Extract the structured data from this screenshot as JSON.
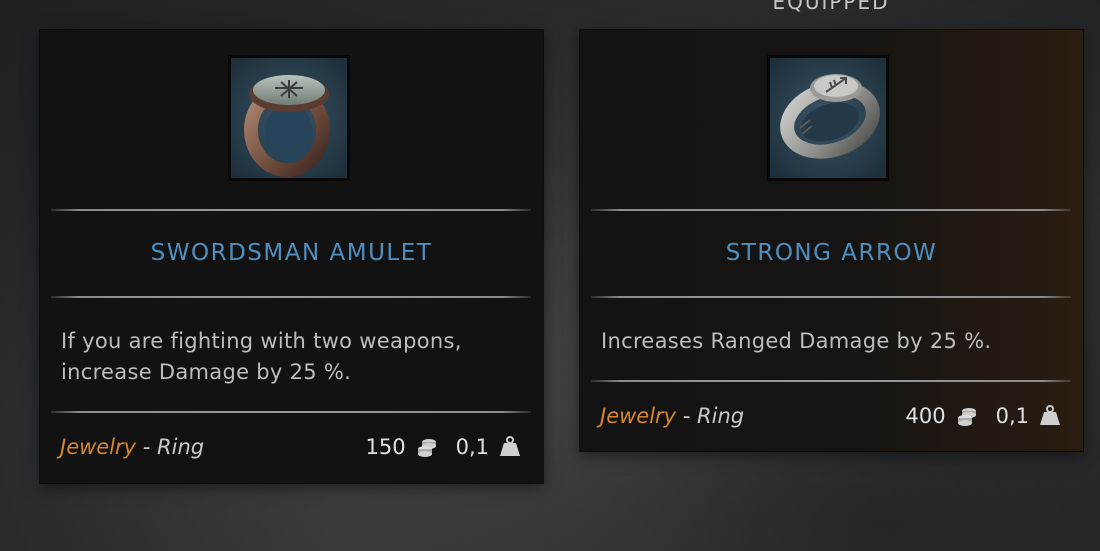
{
  "header": {
    "equipped_label": "EQUIPPED"
  },
  "items": [
    {
      "name": "SWORDSMAN AMULET",
      "description_lines": [
        "If you are fighting with two weapons,",
        "increase Damage by 25 %."
      ],
      "category": "Jewelry",
      "separator": " - ",
      "subtype": "Ring",
      "price": "150",
      "weight": "0,1",
      "icon": "signet-ring-icon",
      "price_icon": "coins-icon",
      "weight_icon": "weight-icon"
    },
    {
      "name": "STRONG ARROW",
      "description_lines": [
        "Increases Ranged Damage by 25 %."
      ],
      "category": "Jewelry",
      "separator": " - ",
      "subtype": "Ring",
      "price": "400",
      "weight": "0,1",
      "icon": "arrow-ring-icon",
      "price_icon": "coins-icon",
      "weight_icon": "weight-icon"
    }
  ],
  "colors": {
    "title": "#4f8fc0",
    "category": "#d6862c",
    "text": "#bdbdbd"
  }
}
